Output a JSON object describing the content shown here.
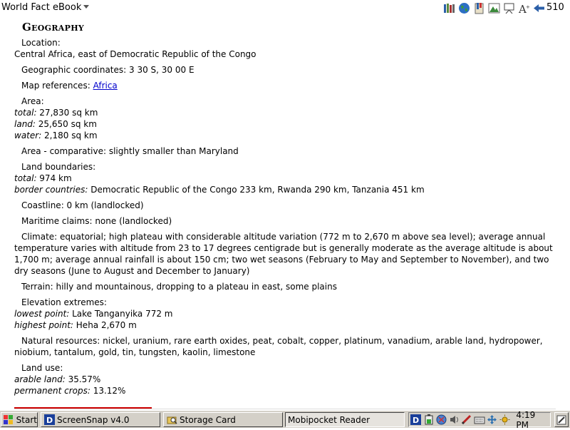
{
  "app": {
    "title": "World Fact eBook",
    "page_number": "510"
  },
  "toolbar_icons": [
    "library-icon",
    "globe-icon",
    "bookmarks-icon",
    "image-icon",
    "presentation-icon",
    "font-size-icon",
    "back-arrow-icon"
  ],
  "section": {
    "heading": "Geography",
    "location": {
      "label": "Location:",
      "value": "Central Africa, east of Democratic Republic of the Congo"
    },
    "coordinates": "Geographic coordinates: 3 30 S, 30 00 E",
    "map_references": {
      "label": "Map references:",
      "link": "Africa"
    },
    "area": {
      "label": "Area:",
      "total_label": "total:",
      "total": " 27,830 sq km",
      "land_label": "land:",
      "land": " 25,650 sq km",
      "water_label": "water:",
      "water": " 2,180 sq km"
    },
    "area_comparative": "Area - comparative: slightly smaller than Maryland",
    "land_boundaries": {
      "label": "Land boundaries:",
      "total_label": "total:",
      "total": " 974 km",
      "border_label": "border countries:",
      "border": " Democratic Republic of the Congo 233 km, Rwanda 290 km, Tanzania 451 km"
    },
    "coastline": "Coastline: 0 km (landlocked)",
    "maritime": "Maritime claims: none (landlocked)",
    "climate": "Climate: equatorial; high plateau with considerable altitude variation (772 m to 2,670 m above sea level); average annual temperature varies with altitude from 23 to 17 degrees centigrade but is generally moderate as the average altitude is about 1,700 m; average annual rainfall is about 150 cm; two wet seasons (February to May and September to November), and two dry seasons (June to August and December to January)",
    "terrain": "Terrain: hilly and mountainous, dropping to a plateau in east, some plains",
    "elevation": {
      "label": "Elevation extremes:",
      "lowest_label": "lowest point:",
      "lowest": " Lake Tanganyika 772 m",
      "highest_label": "highest point:",
      "highest": " Heha 2,670 m"
    },
    "natural_resources": "Natural resources: nickel, uranium, rare earth oxides, peat, cobalt, copper, platinum, vanadium, arable land, hydropower, niobium, tantalum, gold, tin, tungsten, kaolin, limestone",
    "land_use": {
      "label": "Land use:",
      "arable_label": "arable land:",
      "arable": " 35.57%",
      "permanent_label": "permanent crops:",
      "permanent": " 13.12%"
    }
  },
  "reading_progress_fraction": 0.254,
  "taskbar": {
    "start_label": "Start",
    "tasks": [
      "ScreenSnap v4.0",
      "Storage Card",
      "Mobipocket Reader"
    ],
    "clock": "4:19 PM",
    "tray_icons": [
      "mobipocket-icon",
      "battery-icon",
      "network-icon",
      "sound-icon",
      "stylus-icon",
      "keyboard-icon",
      "brightness-icon"
    ]
  },
  "colors": {
    "link": "#0000cc",
    "progress": "#cc0000",
    "taskbar": "#d4d0c8"
  }
}
